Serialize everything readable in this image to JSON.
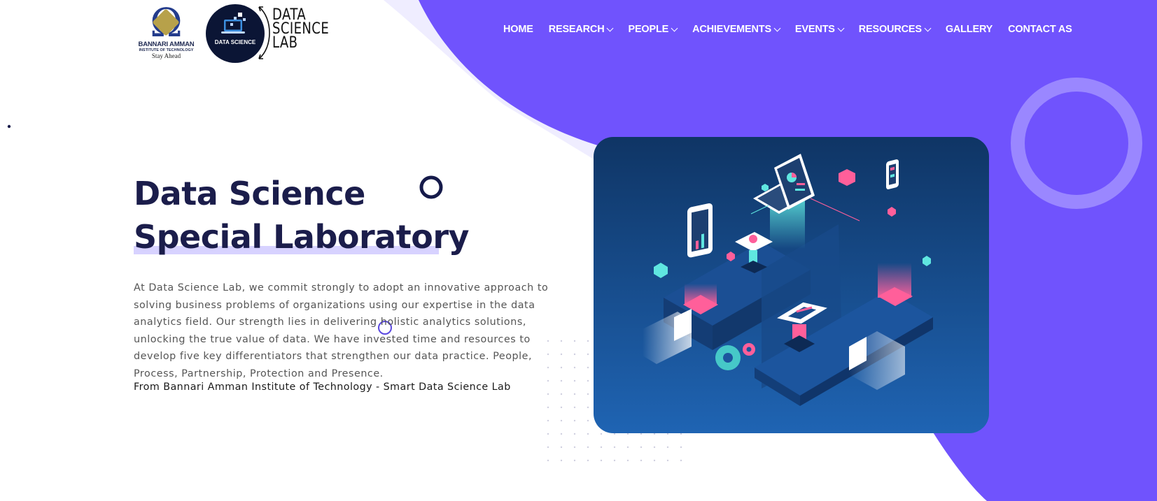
{
  "colors": {
    "accent": "#7053fd",
    "dark": "#1b1d4b",
    "card": "#1d5aa6"
  },
  "logos": {
    "institute_name": "BANNARI AMMAN",
    "institute_sub": "INSTITUTE OF TECHNOLOGY",
    "institute_tagline": "Stay Ahead",
    "lab_badge": "DATA SCIENCE",
    "lab_line1": "DATA",
    "lab_line2": "SCIENCE",
    "lab_line3": "LAB"
  },
  "nav": {
    "items": [
      {
        "label": "HOME",
        "dropdown": false
      },
      {
        "label": "RESEARCH",
        "dropdown": true
      },
      {
        "label": "PEOPLE",
        "dropdown": true
      },
      {
        "label": "ACHIEVEMENTS",
        "dropdown": true
      },
      {
        "label": "EVENTS",
        "dropdown": true
      },
      {
        "label": "RESOURCES",
        "dropdown": true
      },
      {
        "label": "GALLERY",
        "dropdown": false
      },
      {
        "label": "CONTACT AS",
        "dropdown": false
      }
    ]
  },
  "hero": {
    "title_line1": "Data Science",
    "title_line2": "Special Laboratory",
    "description": "At Data Science Lab, we commit strongly to adopt an innovative approach to solving business problems of organizations using our expertise in the data analytics field. Our strength lies in delivering holistic analytics solutions, unlocking the true value of data. We have invested time and resources to develop five key differentiators that strengthen our data practice. People, Process, Partnership, Protection and Presence.",
    "from_line": "From Bannari Amman Institute of Technology - Smart Data Science Lab"
  },
  "illustration": {
    "icon": "isometric-data-platform-illustration"
  }
}
